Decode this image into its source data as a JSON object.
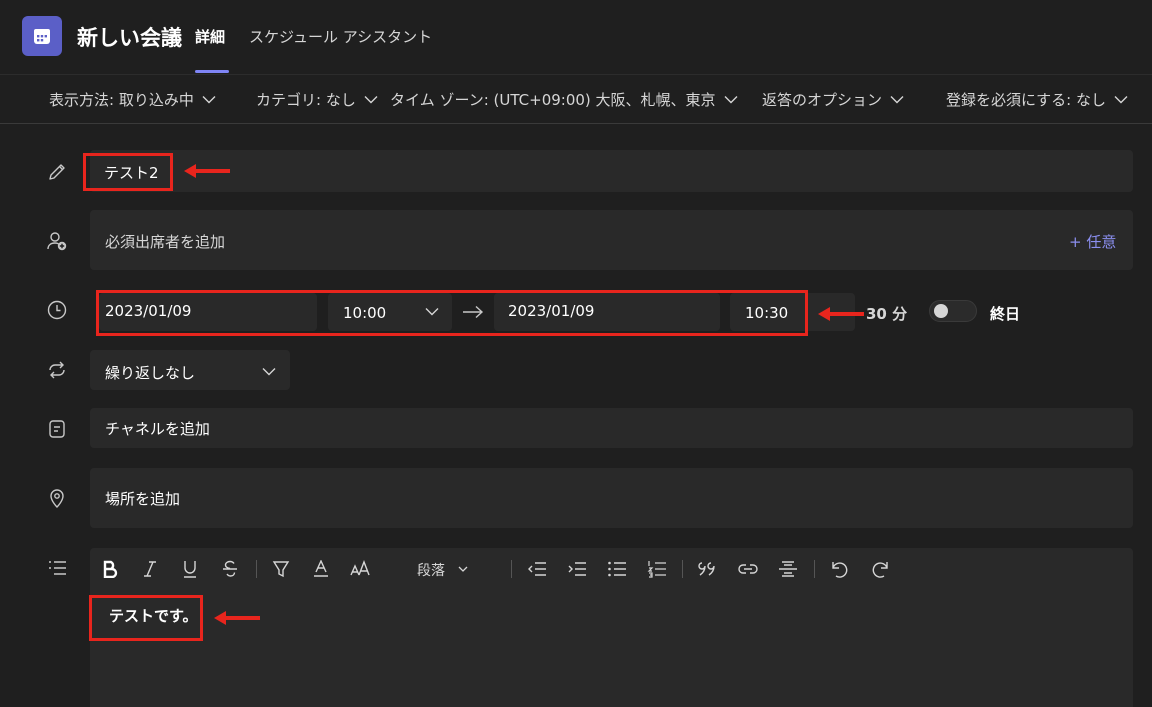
{
  "header": {
    "title": "新しい会議",
    "tabs": [
      {
        "label": "詳細"
      },
      {
        "label": "スケジュール アシスタント"
      }
    ]
  },
  "toolbar": {
    "show_as": "表示方法: 取り込み中",
    "category": "カテゴリ: なし",
    "timezone": "タイム ゾーン: (UTC+09:00) 大阪、札幌、東京",
    "response_options": "返答のオプション",
    "registration": "登録を必須にする: なし"
  },
  "form": {
    "title_value": "テスト2",
    "attendees_placeholder": "必須出席者を追加",
    "optional_link": "+ 任意",
    "start_date": "2023/01/09",
    "start_time": "10:00",
    "end_date": "2023/01/09",
    "end_time": "10:30",
    "duration": "30 分",
    "all_day_label": "終日",
    "all_day_on": false,
    "repeat_value": "繰り返しなし",
    "channel_placeholder": "チャネルを追加",
    "location_placeholder": "場所を追加",
    "paragraph_style": "段落",
    "body_text": "テストです。"
  },
  "colors": {
    "accent": "#5b5fc7",
    "accent_light": "#7f85f5",
    "annotation_red": "#e8251d",
    "background": "#1f1f1f",
    "field_background": "#292929"
  },
  "icons": {
    "app": "calendar-icon",
    "title": "pencil-icon",
    "attendees": "add-person-icon",
    "time": "clock-icon",
    "repeat": "repeat-icon",
    "channel": "channel-icon",
    "location": "location-pin-icon",
    "details": "list-icon"
  }
}
